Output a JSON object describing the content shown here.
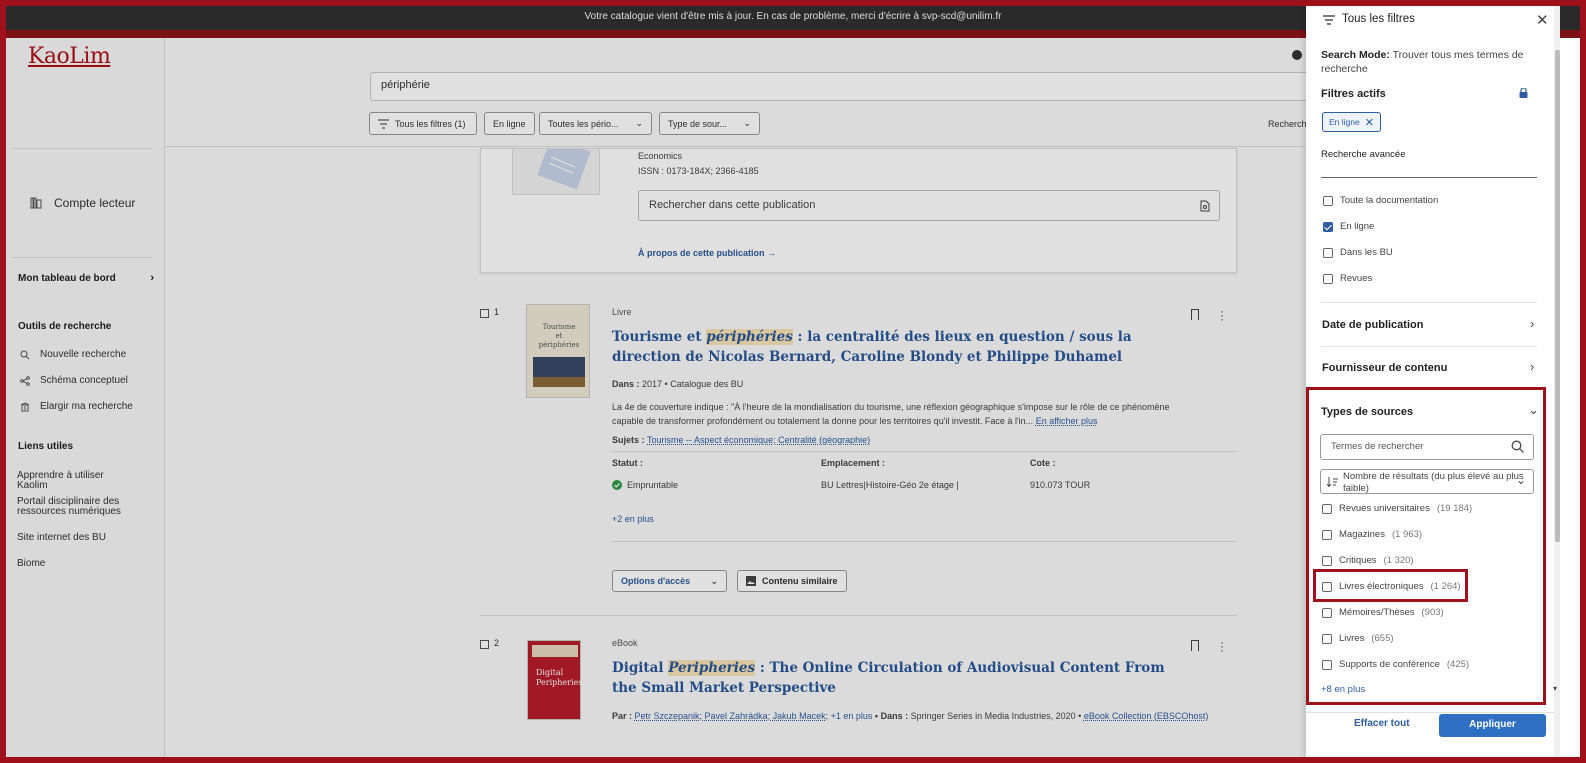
{
  "banner": {
    "message": "Votre catalogue vient d'être mis à jour. En cas de problème, merci d'écrire à svp-scd@unilim.fr"
  },
  "logo": {
    "text": "KaoLim"
  },
  "sidebar": {
    "account": "Compte lecteur",
    "dashboard": "Mon tableau de bord",
    "tools_heading": "Outils de recherche",
    "tools": [
      {
        "label": "Nouvelle recherche",
        "icon": "search-icon"
      },
      {
        "label": "Schéma conceptuel",
        "icon": "concept-map-icon"
      },
      {
        "label": "Elargir ma recherche",
        "icon": "widen-search-icon"
      }
    ],
    "links_heading": "Liens utiles",
    "links": [
      "Apprendre à utiliser Kaolim",
      "Portail disciplinaire des ressources numériques",
      "Site internet des BU",
      "Biome"
    ]
  },
  "search": {
    "value": "périphérie"
  },
  "filters_bar": {
    "all_filters": "Tous les filtres (1)",
    "online": "En ligne",
    "periods": "Toutes les pério...",
    "source_type": "Type de sour...",
    "right_label": "Recherch"
  },
  "publication": {
    "category": "Economics",
    "issn": "ISSN : 0173-184X; 2366-4185",
    "search_placeholder": "Rechercher dans cette publication",
    "about": "À propos de cette publication →"
  },
  "results": [
    {
      "number": "1",
      "type": "Livre",
      "title_pre": "Tourisme et ",
      "title_hl": "périphéries",
      "title_post": " : la centralité des lieux en question / sous la direction de Nicolas Bernard, Caroline Blondy et Philippe Duhamel",
      "meta_label": "Dans : ",
      "meta": "2017 • Catalogue des BU",
      "description": "La 4e de couverture indique : \"À l'heure de la mondialisation du tourisme, une réflexion géographique s'impose sur le rôle de ce phénomène capable de transformer profondément ou totalement la donne pour les territoires qu'il investit. Face à l'in...",
      "more": "En afficher plus",
      "subjects_label": "Sujets : ",
      "subjects": "Tourisme -- Aspect économique; Centralité (géographie)",
      "status_header": "Statut :",
      "location_header": "Emplacement :",
      "call_header": "Cote :",
      "status": "Empruntable",
      "location": "BU Lettres|Histoire-Géo 2e étage |",
      "call_number": "910.073 TOUR",
      "more_items": "+2 en plus",
      "access": "Options d'accès",
      "similar": "Contenu similaire"
    },
    {
      "number": "2",
      "type": "eBook",
      "title_pre": "Digital ",
      "title_hl": "Peripheries",
      "title_post": " : The Online Circulation of Audiovisual Content From the Small Market Perspective",
      "by_label": "Par : ",
      "authors": "Petr Szczepanik; Pavel Zahrádka; Jakub Macek;",
      "authors_more": "+1 en plus",
      "in_label": " • Dans : ",
      "series": "Springer Series in Media Industries, 2020 • ",
      "collection": "eBook Collection (EBSCOhost)"
    }
  ],
  "panel": {
    "title": "Tous les filtres",
    "search_mode_label": "Search Mode:",
    "search_mode_value": " Trouver tous mes termes de recherche",
    "active_filters": "Filtres actifs",
    "chip": "En ligne",
    "advanced": "Recherche avancée",
    "availability": [
      {
        "label": "Toute la documentation",
        "checked": false
      },
      {
        "label": "En ligne",
        "checked": true
      },
      {
        "label": "Dans les BU",
        "checked": false
      },
      {
        "label": "Revues",
        "checked": false
      }
    ],
    "date_section": "Date de publication",
    "provider_section": "Fournisseur de contenu",
    "types_section": "Types de sources",
    "types_search_placeholder": "Termes de rechercher",
    "sort": "Nombre de résultats (du plus élevé au plus faible)",
    "types": [
      {
        "label": "Revues universitaires",
        "count": "(19 184)"
      },
      {
        "label": "Magazines",
        "count": "(1 963)"
      },
      {
        "label": "Critiques",
        "count": "(1 320)"
      },
      {
        "label": "Livres électroniques",
        "count": "(1 264)"
      },
      {
        "label": "Mémoires/Thèses",
        "count": "(903)"
      },
      {
        "label": "Livres",
        "count": "(655)"
      },
      {
        "label": "Supports de conférence",
        "count": "(425)"
      }
    ],
    "more": "+8 en plus",
    "clear": "Effacer tout",
    "apply": "Appliquer"
  },
  "colors": {
    "accent": "#2e5c9e",
    "brand": "#b01117",
    "highlight_frame": "#a0101a"
  }
}
